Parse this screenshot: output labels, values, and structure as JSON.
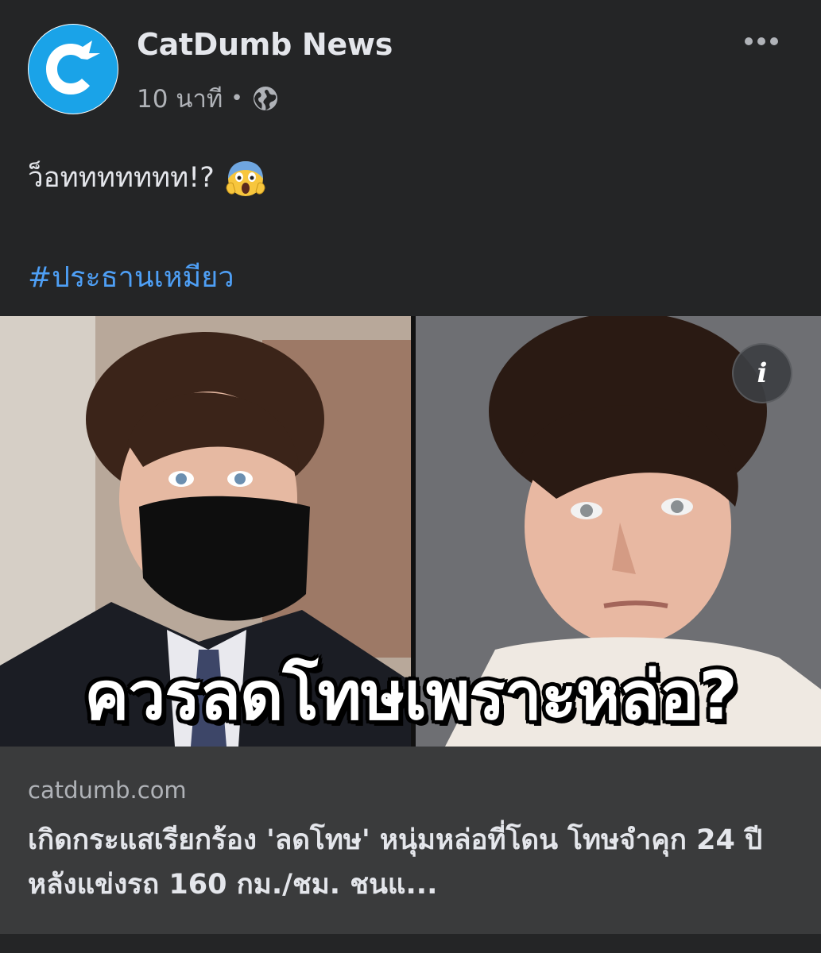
{
  "post": {
    "page_name": "CatDumb News",
    "time": "10 นาที",
    "separator": "•",
    "audience_icon": "globe-icon",
    "caption": "ว็อททททททท!?",
    "caption_emoji": "face-screaming-in-fear",
    "hashtag": "#ประธานเหมียว",
    "menu_icon": "more-horizontal-icon"
  },
  "media": {
    "overlay_text": "ควรลดโทษเพราะหล่อ?",
    "info_icon": "i"
  },
  "link": {
    "domain": "catdumb.com",
    "title": "เกิดกระแสเรียกร้อง 'ลดโทษ' หนุ่มหล่อที่โดน โทษจำคุก 24 ปี หลังแข่งรถ 160 กม./ชม. ชนแ..."
  },
  "colors": {
    "background": "#242526",
    "hashtag": "#4e9ff5",
    "brand": "#1aa3e8",
    "link_preview_bg": "#3a3b3c"
  }
}
